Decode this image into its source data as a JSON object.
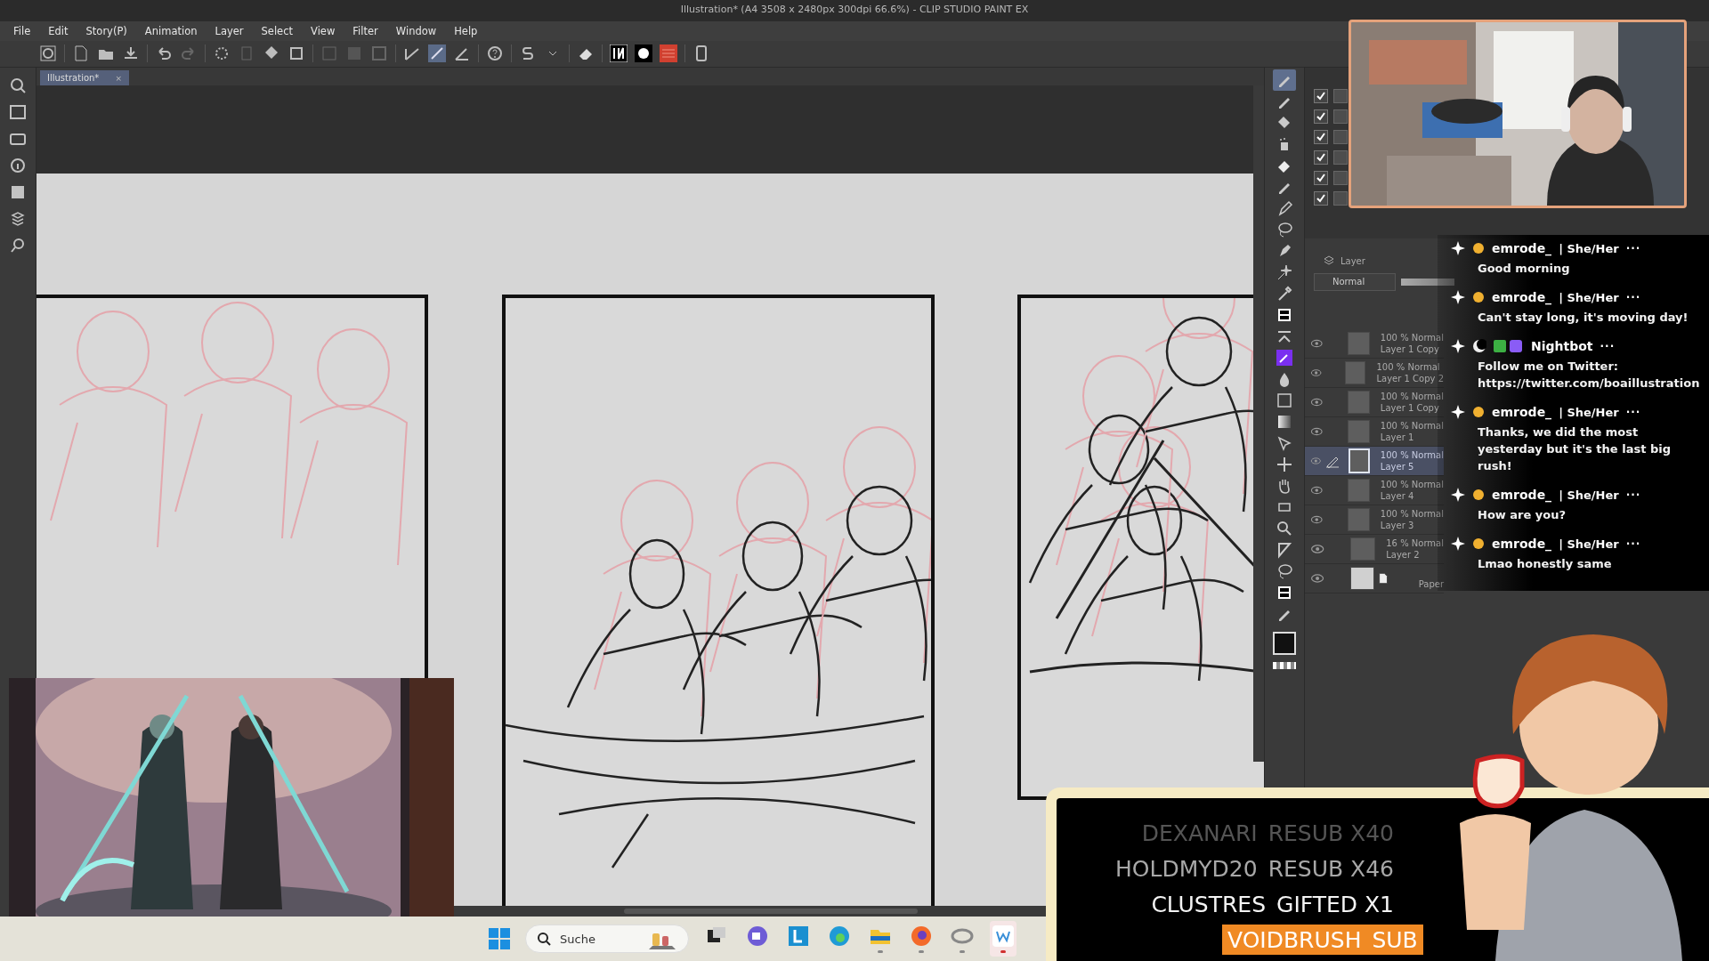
{
  "window": {
    "title": "Illustration* (A4 3508 x 2480px 300dpi 66.6%) - CLIP STUDIO PAINT EX"
  },
  "menu": [
    "File",
    "Edit",
    "Story(P)",
    "Animation",
    "Layer",
    "Select",
    "View",
    "Filter",
    "Window",
    "Help"
  ],
  "document_tab": {
    "label": "Illustration*",
    "close": "×",
    "selected": true
  },
  "tools": [
    {
      "selected": true
    },
    {
      "selected": false
    },
    {
      "selected": false
    },
    {
      "selected": false
    },
    {
      "selected": false
    },
    {
      "selected": false
    },
    {
      "selected": false
    },
    {
      "selected": false
    },
    {
      "selected": false
    },
    {
      "selected": false
    },
    {
      "selected": false
    },
    {
      "selected": false
    },
    {
      "selected": false
    },
    {
      "selected": false
    },
    {
      "selected": false
    },
    {
      "selected": false
    },
    {
      "selected": false
    },
    {
      "selected": false
    },
    {
      "selected": false
    },
    {
      "selected": false
    },
    {
      "selected": false
    },
    {
      "selected": false
    },
    {
      "selected": false
    },
    {
      "selected": false
    },
    {
      "selected": false
    },
    {
      "selected": false
    }
  ],
  "subtool_rows": [
    {
      "checked": true
    },
    {
      "checked": true
    },
    {
      "checked": true
    },
    {
      "checked": true
    },
    {
      "checked": true
    },
    {
      "checked": true
    }
  ],
  "layer_panel": {
    "tab": "Layer",
    "blend_mode": "Normal",
    "opacity": {
      "level": 1
    },
    "layers": [
      {
        "kind": "raster",
        "opacity": "100 % Normal",
        "name": "Layer 1 Copy",
        "selected": false
      },
      {
        "kind": "raster",
        "opacity": "100 % Normal",
        "name": "Layer 1 Copy 2",
        "selected": false
      },
      {
        "kind": "raster",
        "opacity": "100 % Normal",
        "name": "Layer 1 Copy",
        "selected": false
      },
      {
        "kind": "raster",
        "opacity": "100 % Normal",
        "name": "Layer 1",
        "selected": false
      },
      {
        "kind": "raster",
        "opacity": "100 % Normal",
        "name": "Layer 5",
        "selected": true
      },
      {
        "kind": "raster",
        "opacity": "100 % Normal",
        "name": "Layer 4",
        "selected": false
      },
      {
        "kind": "raster",
        "opacity": "100 % Normal",
        "name": "Layer 3",
        "selected": false
      },
      {
        "kind": "raster",
        "opacity": "16 % Normal",
        "name": "Layer 2",
        "selected": false
      },
      {
        "kind": "paper",
        "name": "Paper",
        "selected": false
      }
    ]
  },
  "chat": [
    {
      "kind": "viewer",
      "user": "emrode_",
      "pronouns": "| She/Her",
      "more": "···",
      "text": "Good morning"
    },
    {
      "kind": "viewer",
      "user": "emrode_",
      "pronouns": "| She/Her",
      "more": "···",
      "text": "Can't stay long, it's moving day!"
    },
    {
      "kind": "bot",
      "user": "Nightbot",
      "more": "···",
      "text": "Follow me on Twitter: https://twitter.com/boaillustration"
    },
    {
      "kind": "viewer",
      "user": "emrode_",
      "pronouns": "| She/Her",
      "more": "···",
      "text": "Thanks, we did the most yesterday but it's the last big rush!"
    },
    {
      "kind": "viewer",
      "user": "emrode_",
      "pronouns": "| She/Her",
      "more": "···",
      "text": "How are you?"
    },
    {
      "kind": "viewer",
      "user": "emrode_",
      "pronouns": "| She/Her",
      "more": "···",
      "text": "Lmao honestly same"
    }
  ],
  "alerts": [
    {
      "kind": "faded",
      "name": "DEXANARI",
      "event": "RESUB X40"
    },
    {
      "kind": "dim",
      "name": "HOLDMYD20",
      "event": "RESUB X46"
    },
    {
      "kind": "bright",
      "name": "CLUSTRES",
      "event": "GIFTED X1"
    },
    {
      "kind": "latest",
      "name": "VOIDBRUSH",
      "event": "SUB"
    }
  ],
  "taskbar": {
    "search": {
      "placeholder": "Suche"
    },
    "apps": [
      {
        "running": false,
        "active": false
      },
      {
        "running": false,
        "active": false
      },
      {
        "running": false,
        "active": false
      },
      {
        "running": false,
        "active": false
      },
      {
        "running": true,
        "active": false
      },
      {
        "running": true,
        "active": false
      },
      {
        "running": true,
        "active": false
      },
      {
        "running": true,
        "active": true
      }
    ]
  }
}
